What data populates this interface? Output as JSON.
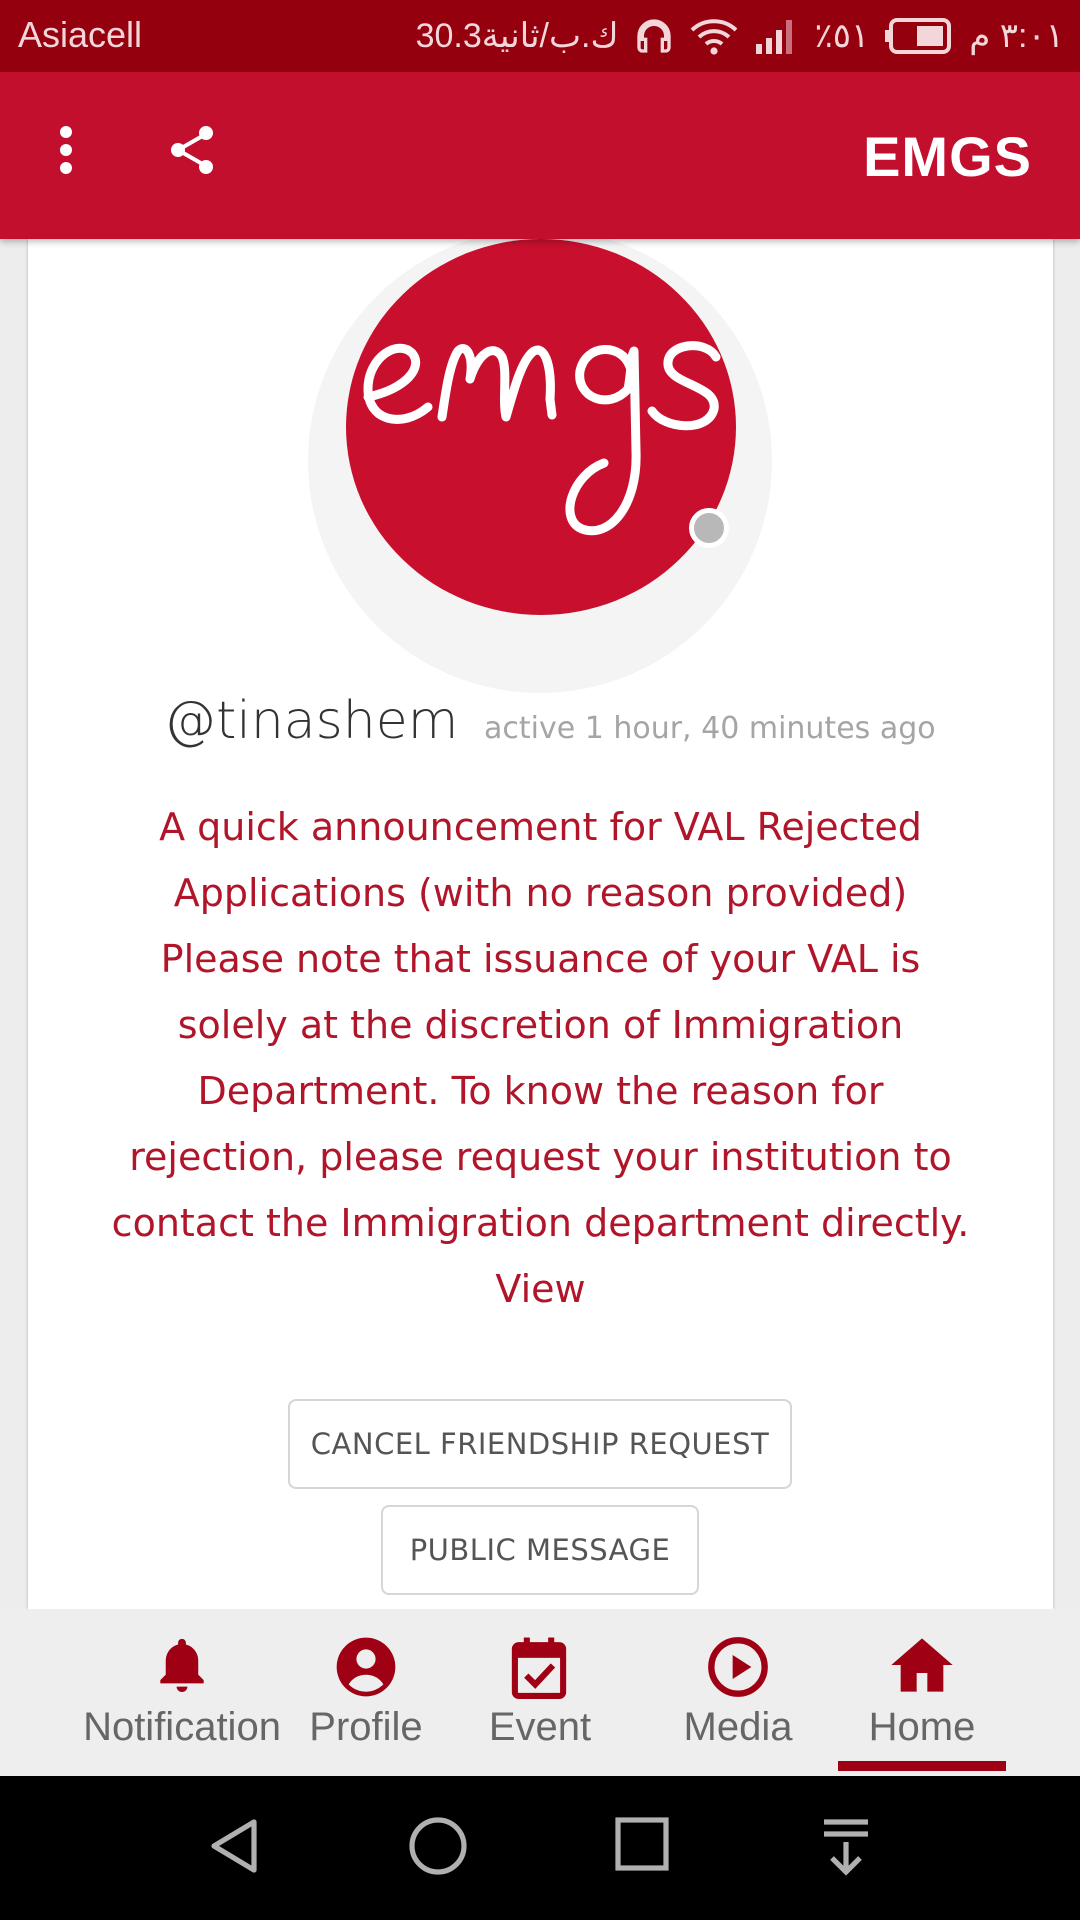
{
  "status_bar": {
    "carrier": "Asiacell",
    "speed": "30.3ك.ب/ثانية",
    "battery": "٪٥١",
    "time": "٣:٠١ م"
  },
  "app_bar": {
    "title": "EMGS",
    "color": "#c20f2e"
  },
  "profile": {
    "username": "@tinashem",
    "activity": "active 1 hour, 40 minutes ago",
    "announcement": "A quick announcement for VAL Rejected Applications (with no reason provided) Please note that issuance of your VAL is solely at the discretion of Immigration Department. To know the reason for rejection, please request your institution to contact the Immigration department directly. View",
    "avatar_logo_text": "emgs"
  },
  "actions": {
    "cancel_friendship": "CANCEL FRIENDSHIP REQUEST",
    "public_message": "PUBLIC MESSAGE"
  },
  "bottom_nav": {
    "items": [
      {
        "label": "Notification",
        "icon": "bell-icon"
      },
      {
        "label": "Profile",
        "icon": "account-circle-icon"
      },
      {
        "label": "Event",
        "icon": "calendar-check-icon"
      },
      {
        "label": "Media",
        "icon": "play-circle-icon"
      },
      {
        "label": "Home",
        "icon": "home-icon",
        "active": true
      }
    ],
    "accent_color": "#a00014"
  },
  "system_nav": {
    "buttons": [
      "back-icon",
      "home-circle-icon",
      "recents-icon",
      "notification-pull-icon"
    ]
  }
}
